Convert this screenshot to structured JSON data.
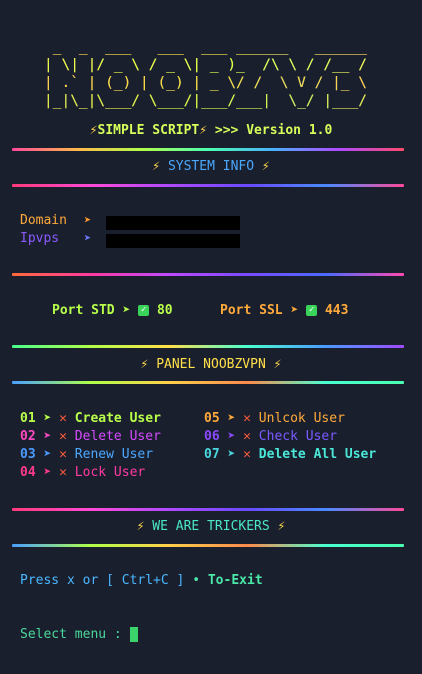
{
  "banner": {
    "ascii_lines": [
      " _  _  ___   ___  ___ ______   ______",
      "| \\| |/ _ \\ / _ \\| _ )_  /\\ \\ / /__ /",
      "| .` | (_) | (_) | _ \\/ /  \\ V / |_ \\",
      "|_|\\_|\\___/ \\___/|___/___|  \\_/ |___/"
    ],
    "script_label": "SIMPLE SCRIPT",
    "arrows": ">>>",
    "version": "Version 1.0"
  },
  "system_info": {
    "title": "SYSTEM INFO",
    "domain_label": "Domain",
    "ipvps_label": "Ipvps"
  },
  "ports": {
    "std_label": "Port STD",
    "std_value": "80",
    "ssl_label": "Port SSL",
    "ssl_value": "443"
  },
  "panel": {
    "title": "PANEL NOOBZVPN"
  },
  "menu": {
    "items": [
      {
        "num": "01",
        "label": "Create User"
      },
      {
        "num": "02",
        "label": "Delete User"
      },
      {
        "num": "03",
        "label": "Renew User"
      },
      {
        "num": "04",
        "label": "Lock User"
      },
      {
        "num": "05",
        "label": "Unlcok User"
      },
      {
        "num": "06",
        "label": "Check User"
      },
      {
        "num": "07",
        "label": "Delete All User"
      }
    ]
  },
  "footer": {
    "title": "WE ARE TRICKERS",
    "exit_hint_prefix": "Press x or [ Ctrl+C ]",
    "exit_bullet": "•",
    "exit_hint_suffix": "To-Exit",
    "prompt": "Select menu :"
  },
  "colors": {
    "background": "#1a1f2e",
    "bolt": "#ffd84a",
    "error_x": "#ff5a3a",
    "check": "#3ad45a",
    "cursor": "#3ad46a"
  },
  "icons": {
    "bolt": "bolt-icon",
    "arrow": "arrow-right-icon",
    "check": "check-box-icon",
    "x": "x-mark-icon"
  }
}
